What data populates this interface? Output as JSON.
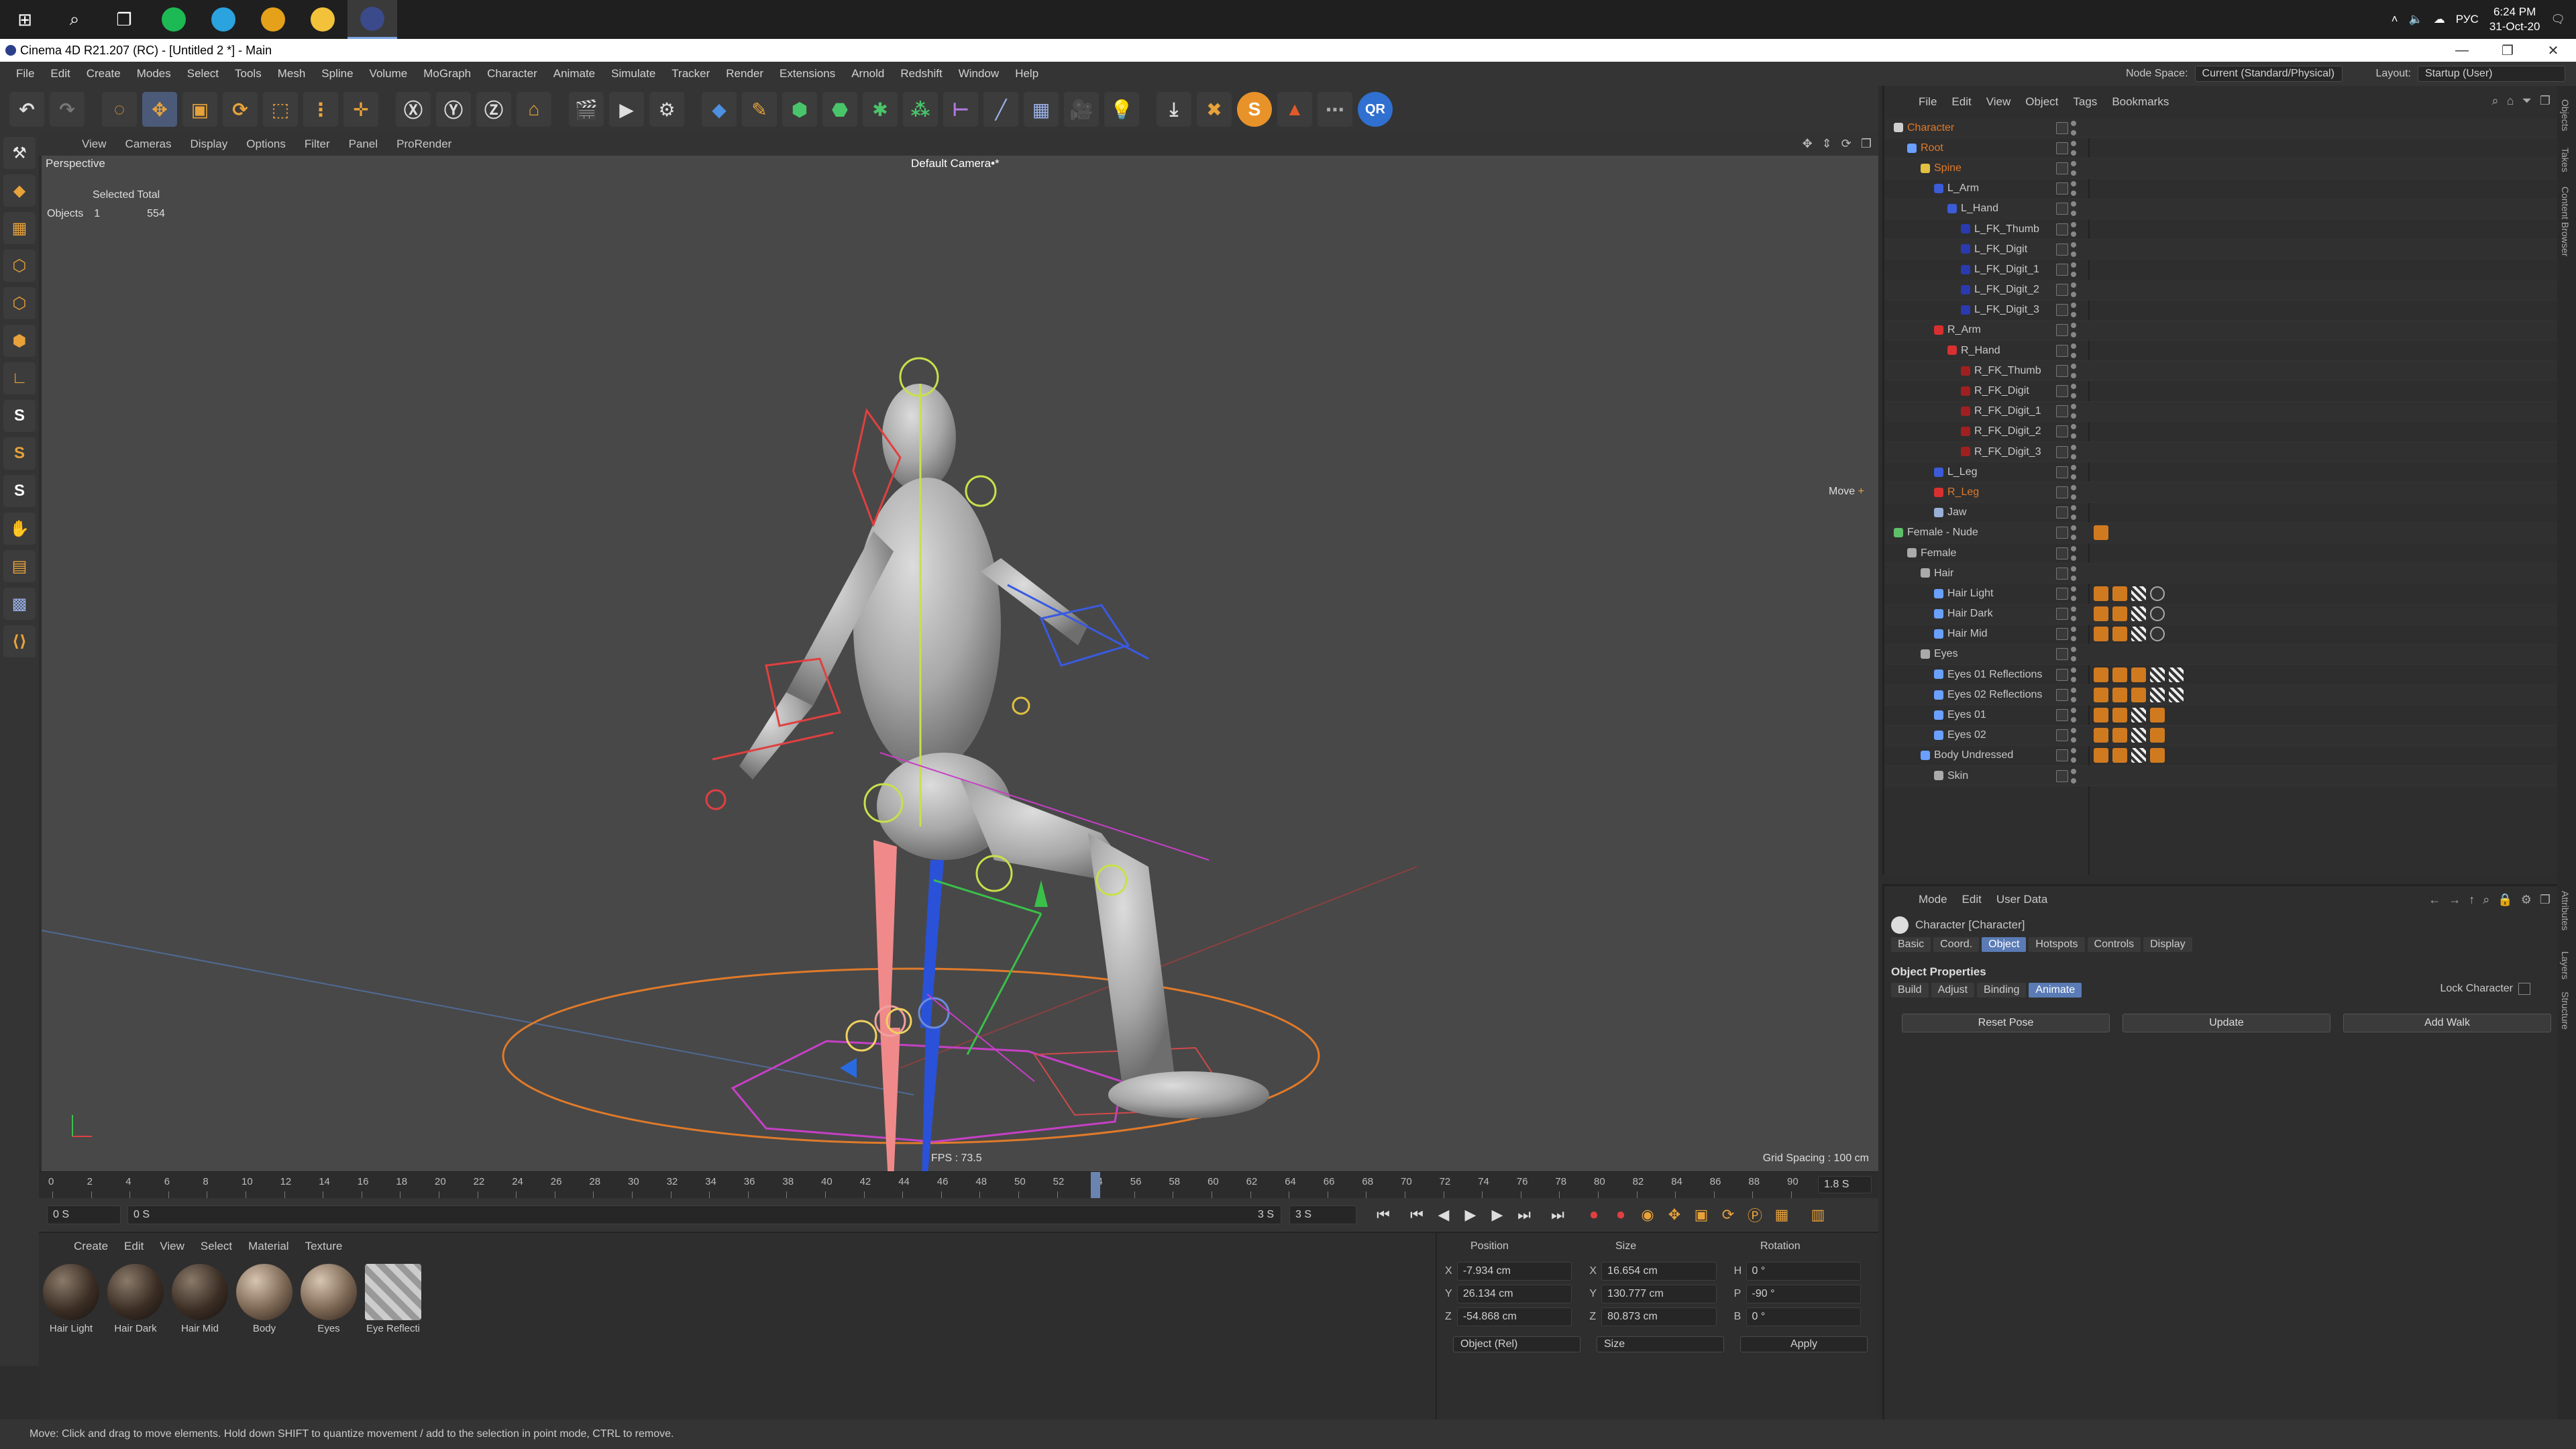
{
  "taskbar": {
    "apps": [
      {
        "name": "spotify-icon",
        "color": "#1db954"
      },
      {
        "name": "telegram-icon",
        "color": "#2aa3df"
      },
      {
        "name": "chrome-icon",
        "color": "#e5a11a"
      },
      {
        "name": "explorer-icon",
        "color": "#f2c23a"
      },
      {
        "name": "cinema4d-icon",
        "color": "#3a4a8a"
      }
    ],
    "lang": "РУС",
    "time": "6:24 PM",
    "date": "31-Oct-20"
  },
  "window": {
    "title": "Cinema 4D R21.207 (RC) - [Untitled 2 *] - Main"
  },
  "menubar": {
    "items": [
      "File",
      "Edit",
      "Create",
      "Modes",
      "Select",
      "Tools",
      "Mesh",
      "Spline",
      "Volume",
      "MoGraph",
      "Character",
      "Animate",
      "Simulate",
      "Tracker",
      "Render",
      "Extensions",
      "Arnold",
      "Redshift",
      "Window",
      "Help"
    ],
    "node_space_label": "Node Space:",
    "node_space_value": "Current (Standard/Physical)",
    "layout_label": "Layout:",
    "layout_value": "Startup (User)"
  },
  "viewport": {
    "menu": [
      "View",
      "Cameras",
      "Display",
      "Options",
      "Filter",
      "Panel",
      "ProRender"
    ],
    "label": "Perspective",
    "camera": "Default Camera",
    "camera_suffix": "•*",
    "hud_header": "Selected Total",
    "hud_row_label": "Objects",
    "hud_selected": "1",
    "hud_total": "554",
    "fps": "FPS : 73.5",
    "grid_spacing": "Grid Spacing : 100 cm",
    "move_hint": "Move"
  },
  "timeline": {
    "ticks": [
      "0",
      "2",
      "4",
      "6",
      "8",
      "10",
      "12",
      "14",
      "16",
      "18",
      "20",
      "22",
      "24",
      "26",
      "28",
      "30",
      "32",
      "34",
      "36",
      "38",
      "40",
      "42",
      "44",
      "46",
      "48",
      "50",
      "52",
      "54",
      "56",
      "58",
      "60",
      "62",
      "64",
      "66",
      "68",
      "70",
      "72",
      "74",
      "76",
      "78",
      "80",
      "82",
      "84",
      "86",
      "88",
      "90"
    ],
    "end_field": "1.8 S",
    "current_frame": 54,
    "frame_range_end": 90
  },
  "transport": {
    "start": "0 S",
    "start2": "0 S",
    "end": "3 S",
    "end2": "3 S"
  },
  "material_manager": {
    "menu": [
      "Create",
      "Edit",
      "View",
      "Select",
      "Material",
      "Texture"
    ],
    "materials": [
      {
        "name": "Hair Light",
        "style": "hair"
      },
      {
        "name": "Hair Dark",
        "style": "hair"
      },
      {
        "name": "Hair Mid",
        "style": "hair"
      },
      {
        "name": "Body",
        "style": "light"
      },
      {
        "name": "Eyes",
        "style": "light"
      },
      {
        "name": "Eye Reflecti",
        "style": "refl"
      }
    ]
  },
  "coords": {
    "headers": [
      "Position",
      "Size",
      "Rotation"
    ],
    "rows": [
      {
        "axis": "X",
        "pos": "-7.934 cm",
        "size_axis": "X",
        "size": "16.654 cm",
        "rot_axis": "H",
        "rot": "0 °"
      },
      {
        "axis": "Y",
        "pos": "26.134 cm",
        "size_axis": "Y",
        "size": "130.777 cm",
        "rot_axis": "P",
        "rot": "-90 °"
      },
      {
        "axis": "Z",
        "pos": "-54.868 cm",
        "size_axis": "Z",
        "size": "80.873 cm",
        "rot_axis": "B",
        "rot": "0 °"
      }
    ],
    "mode": "Object (Rel)",
    "size_mode": "Size",
    "apply": "Apply"
  },
  "object_manager": {
    "menu": [
      "File",
      "Edit",
      "View",
      "Object",
      "Tags",
      "Bookmarks"
    ],
    "objects": [
      {
        "name": "Character",
        "depth": 0,
        "color": "#e07a2a",
        "icon": "#cfcfcf",
        "tags": []
      },
      {
        "name": "Root",
        "depth": 1,
        "color": "#e07a2a",
        "icon": "#6aa0ff",
        "tags": []
      },
      {
        "name": "Spine",
        "depth": 2,
        "color": "#e07a2a",
        "icon": "#e2c040",
        "tags": []
      },
      {
        "name": "L_Arm",
        "depth": 3,
        "color": "#c8c8c8",
        "icon": "#3b5bd8",
        "tags": []
      },
      {
        "name": "L_Hand",
        "depth": 4,
        "color": "#c8c8c8",
        "icon": "#3b5bd8",
        "tags": []
      },
      {
        "name": "L_FK_Thumb",
        "depth": 5,
        "color": "#c8c8c8",
        "icon": "#2a3ab0",
        "tags": []
      },
      {
        "name": "L_FK_Digit",
        "depth": 5,
        "color": "#c8c8c8",
        "icon": "#2a3ab0",
        "tags": []
      },
      {
        "name": "L_FK_Digit_1",
        "depth": 5,
        "color": "#c8c8c8",
        "icon": "#2a3ab0",
        "tags": []
      },
      {
        "name": "L_FK_Digit_2",
        "depth": 5,
        "color": "#c8c8c8",
        "icon": "#2a3ab0",
        "tags": []
      },
      {
        "name": "L_FK_Digit_3",
        "depth": 5,
        "color": "#c8c8c8",
        "icon": "#2a3ab0",
        "tags": []
      },
      {
        "name": "R_Arm",
        "depth": 3,
        "color": "#c8c8c8",
        "icon": "#d83030",
        "tags": []
      },
      {
        "name": "R_Hand",
        "depth": 4,
        "color": "#c8c8c8",
        "icon": "#d83030",
        "tags": []
      },
      {
        "name": "R_FK_Thumb",
        "depth": 5,
        "color": "#c8c8c8",
        "icon": "#a02020",
        "tags": []
      },
      {
        "name": "R_FK_Digit",
        "depth": 5,
        "color": "#c8c8c8",
        "icon": "#a02020",
        "tags": []
      },
      {
        "name": "R_FK_Digit_1",
        "depth": 5,
        "color": "#c8c8c8",
        "icon": "#a02020",
        "tags": []
      },
      {
        "name": "R_FK_Digit_2",
        "depth": 5,
        "color": "#c8c8c8",
        "icon": "#a02020",
        "tags": []
      },
      {
        "name": "R_FK_Digit_3",
        "depth": 5,
        "color": "#c8c8c8",
        "icon": "#a02020",
        "tags": []
      },
      {
        "name": "L_Leg",
        "depth": 3,
        "color": "#c8c8c8",
        "icon": "#3b5bd8",
        "tags": []
      },
      {
        "name": "R_Leg",
        "depth": 3,
        "color": "#e07a2a",
        "icon": "#d83030",
        "tags": []
      },
      {
        "name": "Jaw",
        "depth": 3,
        "color": "#c8c8c8",
        "icon": "#9ab0d8",
        "tags": []
      },
      {
        "name": "Female - Nude",
        "depth": 0,
        "color": "#c8c8c8",
        "icon": "#5fc06a",
        "tags": [
          "o"
        ]
      },
      {
        "name": "Female",
        "depth": 1,
        "color": "#c8c8c8",
        "icon": "#aaaaaa",
        "tags": []
      },
      {
        "name": "Hair",
        "depth": 2,
        "color": "#c8c8c8",
        "icon": "#aaaaaa",
        "tags": []
      },
      {
        "name": "Hair Light",
        "depth": 3,
        "color": "#c8c8c8",
        "icon": "#6aa0ff",
        "tags": [
          "o",
          "o",
          "c",
          "b"
        ]
      },
      {
        "name": "Hair Dark",
        "depth": 3,
        "color": "#c8c8c8",
        "icon": "#6aa0ff",
        "tags": [
          "o",
          "o",
          "c",
          "b"
        ]
      },
      {
        "name": "Hair Mid",
        "depth": 3,
        "color": "#c8c8c8",
        "icon": "#6aa0ff",
        "tags": [
          "o",
          "o",
          "c",
          "b"
        ]
      },
      {
        "name": "Eyes",
        "depth": 2,
        "color": "#c8c8c8",
        "icon": "#aaaaaa",
        "tags": []
      },
      {
        "name": "Eyes 01 Reflections",
        "depth": 3,
        "color": "#c8c8c8",
        "icon": "#6aa0ff",
        "tags": [
          "o",
          "o",
          "o",
          "c",
          "c"
        ]
      },
      {
        "name": "Eyes 02 Reflections",
        "depth": 3,
        "color": "#c8c8c8",
        "icon": "#6aa0ff",
        "tags": [
          "o",
          "o",
          "o",
          "c",
          "c"
        ]
      },
      {
        "name": "Eyes 01",
        "depth": 3,
        "color": "#c8c8c8",
        "icon": "#6aa0ff",
        "tags": [
          "o",
          "o",
          "c",
          "o"
        ]
      },
      {
        "name": "Eyes 02",
        "depth": 3,
        "color": "#c8c8c8",
        "icon": "#6aa0ff",
        "tags": [
          "o",
          "o",
          "c",
          "o"
        ]
      },
      {
        "name": "Body Undressed",
        "depth": 2,
        "color": "#c8c8c8",
        "icon": "#6aa0ff",
        "tags": [
          "o",
          "o",
          "c",
          "o"
        ]
      },
      {
        "name": "Skin",
        "depth": 3,
        "color": "#c8c8c8",
        "icon": "#aaaaaa",
        "tags": []
      }
    ]
  },
  "attributes": {
    "menu": [
      "Mode",
      "Edit",
      "User Data"
    ],
    "object_title": "Character [Character]",
    "tabs": [
      "Basic",
      "Coord.",
      "Object",
      "Hotspots",
      "Controls",
      "Display"
    ],
    "selected_tab": "Object",
    "section": "Object Properties",
    "subtabs": [
      "Build",
      "Adjust",
      "Binding",
      "Animate"
    ],
    "selected_subtab": "Animate",
    "lock_character": "Lock Character",
    "buttons": [
      "Reset Pose",
      "Update",
      "Add Walk"
    ]
  },
  "side_rail": [
    "Objects",
    "Takes",
    "Content Browser",
    "Attributes",
    "Layers",
    "Structure"
  ],
  "status": "Move: Click and drag to move elements. Hold down SHIFT to quantize movement / add to the selection in point mode, CTRL to remove."
}
